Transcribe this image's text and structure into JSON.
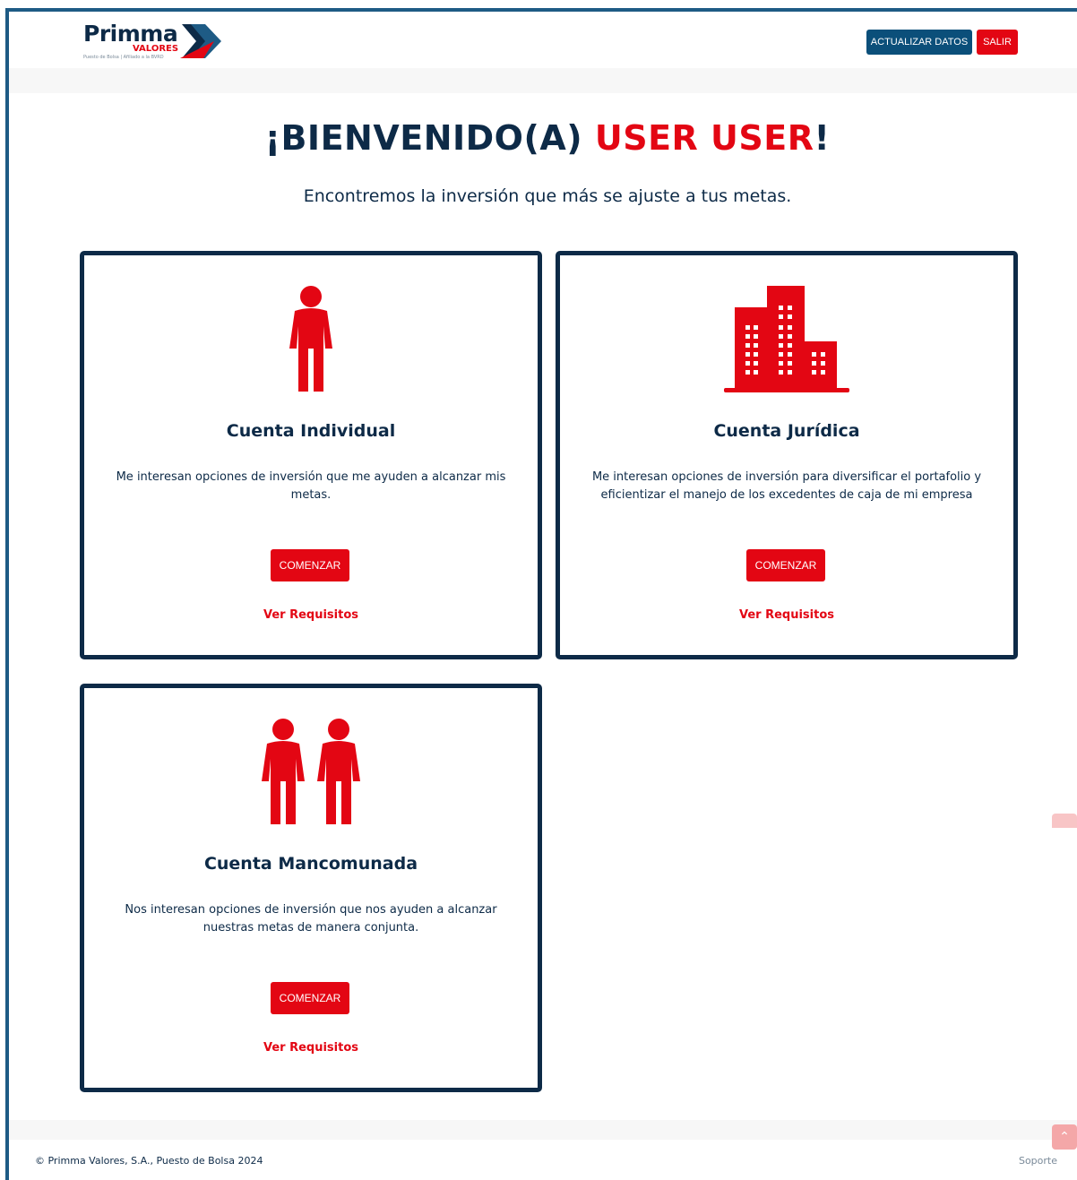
{
  "header": {
    "logo": {
      "word": "Primma",
      "sub": "VALORES",
      "tagline": "Puesto de Bolsa | Afiliado a la BVRD"
    },
    "update_button": "ACTUALIZAR DATOS",
    "exit_button": "SALIR"
  },
  "welcome": {
    "prefix": "¡BIENVENIDO(A) ",
    "name": "USER USER",
    "suffix": "!",
    "subtitle": "Encontremos la inversión que más se ajuste a tus metas."
  },
  "cards": [
    {
      "icon": "person-icon",
      "title": "Cuenta Individual",
      "description": "Me interesan opciones de inversión que me ayuden a alcanzar mis metas.",
      "button": "COMENZAR",
      "link": "Ver Requisitos"
    },
    {
      "icon": "buildings-icon",
      "title": "Cuenta Jurídica",
      "description": "Me interesan opciones de inversión para diversificar el portafolio y eficientizar el manejo de los excedentes de caja de mi empresa",
      "button": "COMENZAR",
      "link": "Ver Requisitos"
    },
    {
      "icon": "two-persons-icon",
      "title": "Cuenta Mancomunada",
      "description": "Nos interesan opciones de inversión que nos ayuden a alcanzar nuestras metas de manera conjunta.",
      "button": "COMENZAR",
      "link": "Ver Requisitos"
    }
  ],
  "footer": {
    "copyright": "© Primma Valores, S.A., Puesto de Bolsa 2024",
    "support": "Soporte"
  },
  "colors": {
    "navy": "#0d2a47",
    "brand_blue": "#0b4f7a",
    "brand_red": "#e30613"
  }
}
